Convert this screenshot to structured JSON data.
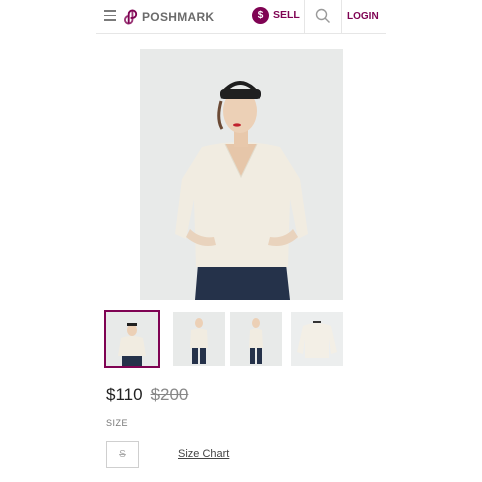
{
  "header": {
    "menu_icon": "hamburger-menu-icon",
    "brand_name": "POSHMARK",
    "sell_badge": "$",
    "sell_label": "SELL",
    "search_icon": "search-icon",
    "login_label": "LOGIN",
    "accent_color": "#7f0353"
  },
  "listing": {
    "price": "$110",
    "original_price": "$200",
    "size_heading": "SIZE",
    "size_value": "S",
    "size_chart_label": "Size Chart"
  },
  "gallery": {
    "thumbnail_count": 4,
    "active_thumbnail_index": 0
  }
}
